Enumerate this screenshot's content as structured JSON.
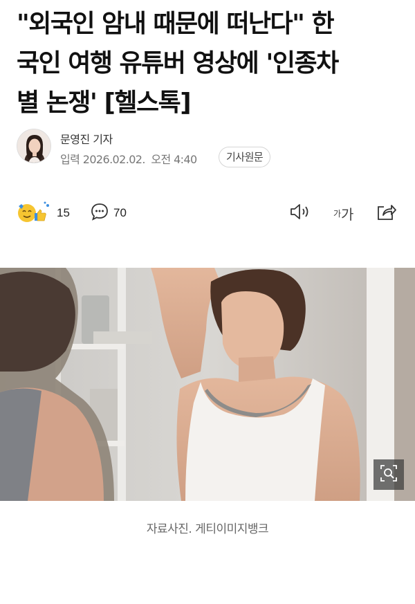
{
  "article": {
    "headline_lines": [
      "\"외국인 암내 때문에 떠난다\" 한",
      "국인 여행 유튜버 영상에 '인종차",
      "별 논쟁' [헬스톡]"
    ]
  },
  "byline": {
    "reporter": "문영진 기자",
    "published_label": "입력",
    "published_date": "2026.02.02.",
    "published_time": "오전 4:40",
    "original_button": "기사원문"
  },
  "actions": {
    "reaction_count": "15",
    "comment_count": "70",
    "font_small": "가",
    "font_large": "가"
  },
  "photo": {
    "caption": "자료사진. 게티이미지뱅크"
  },
  "icons": {
    "reaction": "emoji-reaction-icon",
    "comment": "speech-bubble-icon",
    "tts": "speaker-icon",
    "share": "share-icon",
    "zoom": "magnify-icon"
  },
  "colors": {
    "text": "#111111",
    "muted": "#777777",
    "emoji_yellow": "#f6c531",
    "emoji_blue": "#3d8fe0"
  }
}
